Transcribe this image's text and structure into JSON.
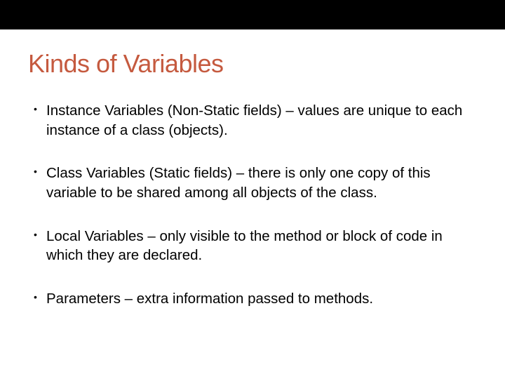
{
  "title": "Kinds of Variables",
  "bullets": [
    "Instance Variables (Non-Static fields) – values are unique to each instance of a class (objects).",
    "Class Variables (Static fields) – there is only one copy of this variable to be shared among all objects of the class.",
    "Local Variables – only visible to the method or block of code in which they are declared.",
    "Parameters – extra information passed to methods."
  ]
}
